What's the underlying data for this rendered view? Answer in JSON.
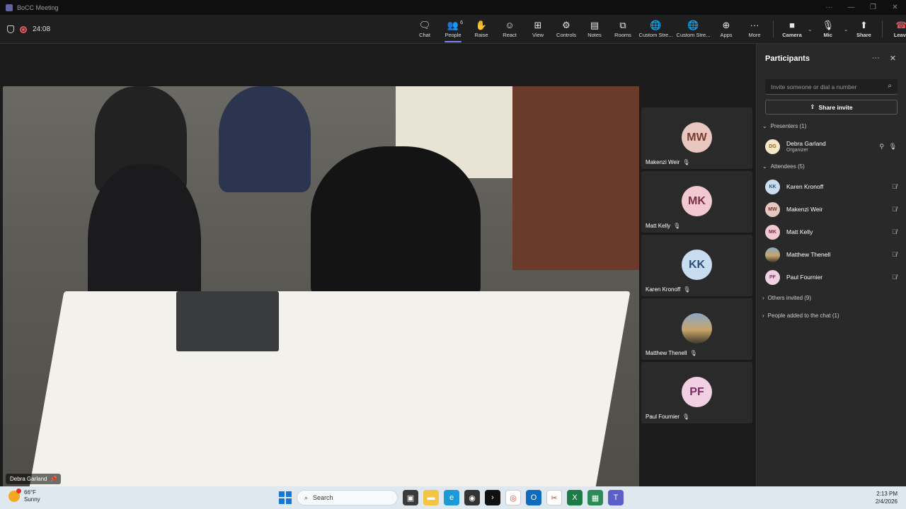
{
  "window": {
    "title": "BoCC Meeting"
  },
  "toolbar": {
    "timer": "24:08",
    "items": [
      {
        "label": "Chat",
        "icon": "chat-icon"
      },
      {
        "label": "People",
        "icon": "people-icon",
        "count": "6"
      },
      {
        "label": "Raise",
        "icon": "raise-hand-icon"
      },
      {
        "label": "React",
        "icon": "react-icon"
      },
      {
        "label": "View",
        "icon": "view-icon"
      },
      {
        "label": "Controls",
        "icon": "controls-icon"
      },
      {
        "label": "Notes",
        "icon": "notes-icon"
      },
      {
        "label": "Rooms",
        "icon": "rooms-icon"
      },
      {
        "label": "Custom Stre...",
        "icon": "globe-icon"
      },
      {
        "label": "Custom Stre...",
        "icon": "globe-icon"
      },
      {
        "label": "Apps",
        "icon": "apps-icon"
      },
      {
        "label": "More",
        "icon": "more-icon"
      }
    ],
    "camera": "Camera",
    "mic": "Mic",
    "share": "Share",
    "leave": "Leave"
  },
  "main_video": {
    "name": "Debra Garland"
  },
  "tiles": [
    {
      "initials": "MW",
      "name": "Makenzi Weir",
      "bg": "#e8c7c0",
      "fg": "#7a3b2f"
    },
    {
      "initials": "MK",
      "name": "Matt Kelly",
      "bg": "#f2c9d2",
      "fg": "#7a2f44"
    },
    {
      "initials": "KK",
      "name": "Karen Kronoff",
      "bg": "#c9ddf0",
      "fg": "#2f4f7a"
    },
    {
      "initials": "",
      "name": "Matthew Thenell",
      "bg": "#6b5a4a",
      "fg": "#fff"
    },
    {
      "initials": "PF",
      "name": "Paul Fournier",
      "bg": "#f2d0e4",
      "fg": "#7a2f5e"
    }
  ],
  "panel": {
    "title": "Participants",
    "invite_placeholder": "Invite someone or dial a number",
    "share_invite": "Share invite",
    "presenters_label": "Presenters (1)",
    "presenter": {
      "initials": "DG",
      "name": "Debra Garland",
      "role": "Organizer",
      "bg": "#f5e6c8",
      "fg": "#8a6a2a"
    },
    "attendees_label": "Attendees (5)",
    "attendees": [
      {
        "initials": "KK",
        "name": "Karen Kronoff",
        "bg": "#c9ddf0",
        "fg": "#2f4f7a"
      },
      {
        "initials": "MW",
        "name": "Makenzi Weir",
        "bg": "#e8c7c0",
        "fg": "#7a3b2f"
      },
      {
        "initials": "MK",
        "name": "Matt Kelly",
        "bg": "#f2c9d2",
        "fg": "#7a2f44"
      },
      {
        "initials": "",
        "name": "Matthew Thenell",
        "bg": "#6b5a4a",
        "fg": "#fff"
      },
      {
        "initials": "PF",
        "name": "Paul Fournier",
        "bg": "#f2d0e4",
        "fg": "#7a2f5e"
      }
    ],
    "others_invited": "Others invited (9)",
    "added_to_chat": "People added to the chat (1)"
  },
  "taskbar": {
    "temp": "66°F",
    "condition": "Sunny",
    "search": "Search",
    "time": "2:13 PM",
    "date": "2/4/2026"
  }
}
